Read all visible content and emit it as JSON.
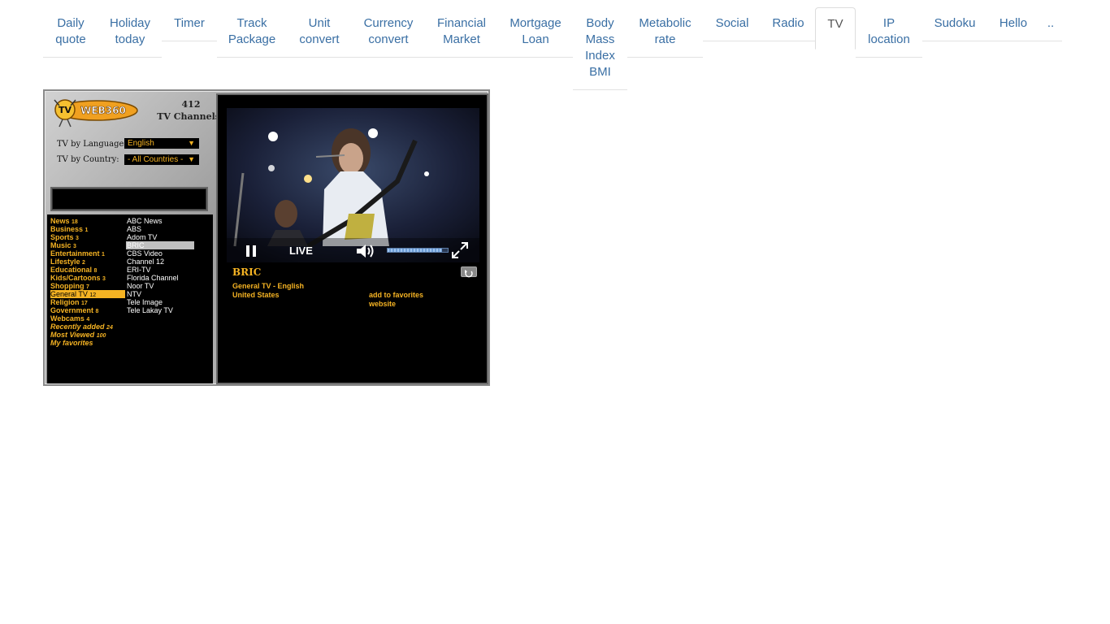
{
  "tabs": [
    {
      "lines": [
        "Daily",
        "quote"
      ],
      "active": false
    },
    {
      "lines": [
        "Holiday",
        "today"
      ],
      "active": false
    },
    {
      "lines": [
        "Timer"
      ],
      "active": false
    },
    {
      "lines": [
        "Track",
        "Package"
      ],
      "active": false
    },
    {
      "lines": [
        "Unit",
        "convert"
      ],
      "active": false
    },
    {
      "lines": [
        "Currency",
        "convert"
      ],
      "active": false
    },
    {
      "lines": [
        "Financial",
        "Market"
      ],
      "active": false
    },
    {
      "lines": [
        "Mortgage",
        "Loan"
      ],
      "active": false
    },
    {
      "lines": [
        "Body",
        "Mass",
        "Index",
        "BMI"
      ],
      "active": false
    },
    {
      "lines": [
        "Metabolic",
        "rate"
      ],
      "active": false
    },
    {
      "lines": [
        "Social"
      ],
      "active": false
    },
    {
      "lines": [
        "Radio"
      ],
      "active": false
    },
    {
      "lines": [
        "TV"
      ],
      "active": true
    },
    {
      "lines": [
        "IP",
        "location"
      ],
      "active": false
    },
    {
      "lines": [
        "Sudoku"
      ],
      "active": false
    },
    {
      "lines": [
        "Hello"
      ],
      "active": false
    },
    {
      "lines": [
        ".."
      ],
      "active": false
    }
  ],
  "tv": {
    "logo_text": "WEB360",
    "logo_badge": "TV",
    "channel_count": "412",
    "channel_count_label": "TV Channels",
    "language_label": "TV by Language:",
    "language_value": "English",
    "country_label": "TV by Country:",
    "country_value": "- All Countries -",
    "categories": [
      {
        "name": "News",
        "count": "18"
      },
      {
        "name": "Business",
        "count": "1"
      },
      {
        "name": "Sports",
        "count": "3"
      },
      {
        "name": "Music",
        "count": "3"
      },
      {
        "name": "Entertainment",
        "count": "1"
      },
      {
        "name": "Lifestyle",
        "count": "2"
      },
      {
        "name": "Educational",
        "count": "8"
      },
      {
        "name": "Kids/Cartoons",
        "count": "3"
      },
      {
        "name": "Shopping",
        "count": "7"
      },
      {
        "name": "General TV",
        "count": "12",
        "selected": true
      },
      {
        "name": "Religion",
        "count": "17"
      },
      {
        "name": "Government",
        "count": "8"
      },
      {
        "name": "Webcams",
        "count": "4"
      },
      {
        "name": "Recently added",
        "count": "24",
        "italic": true
      },
      {
        "name": "Most Viewed",
        "count": "100",
        "italic": true
      },
      {
        "name": "My favorites",
        "count": "",
        "italic": true
      }
    ],
    "channels": [
      {
        "name": "ABC News"
      },
      {
        "name": "ABS"
      },
      {
        "name": "Adom TV"
      },
      {
        "name": "BRIC",
        "selected": true
      },
      {
        "name": "CBS Video"
      },
      {
        "name": "Channel 12"
      },
      {
        "name": "ERI-TV"
      },
      {
        "name": "Florida Channel"
      },
      {
        "name": "Noor TV"
      },
      {
        "name": "NTV"
      },
      {
        "name": "Tele Image"
      },
      {
        "name": "Tele Lakay TV"
      }
    ],
    "player": {
      "live_label": "LIVE",
      "volume_level": 0.9
    },
    "info": {
      "title": "BRIC",
      "genre_language": "General TV - English",
      "country": "United States",
      "add_favorites": "add to favorites",
      "website": "website"
    }
  },
  "colors": {
    "accent": "#f5b323",
    "link": "#3a6fa4"
  }
}
